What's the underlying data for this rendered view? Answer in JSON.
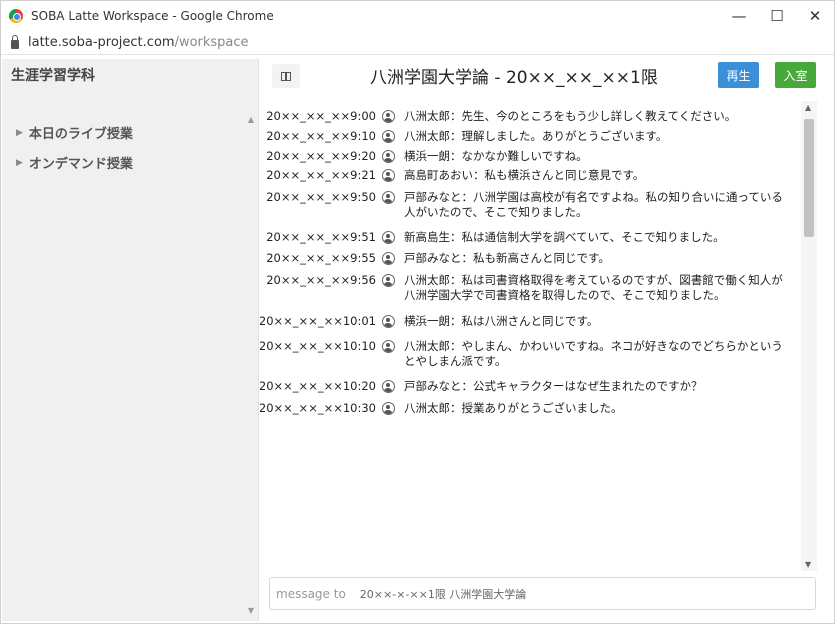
{
  "window": {
    "title": "SOBA Latte Workspace - Google Chrome",
    "controls": {
      "minimize": "—",
      "maximize": "☐",
      "close": "✕"
    }
  },
  "address": {
    "host": "latte.soba-project.com",
    "path": "/workspace"
  },
  "sidebar": {
    "title": "生涯学習学科",
    "items": [
      {
        "label": "本日のライブ授業"
      },
      {
        "label": "オンデマンド授業"
      }
    ]
  },
  "header": {
    "room_title": "八洲学園大学論 - 20××_××_××1限",
    "play_label": "再生",
    "enter_label": "入室"
  },
  "messages": [
    {
      "time": "20××_××_××9:00",
      "text": "八洲太郎：先生、今のところをもう少し詳しく教えてください。"
    },
    {
      "time": "20××_××_××9:10",
      "text": "八洲太郎：理解しました。ありがとうございます。"
    },
    {
      "time": "20××_××_××9:20",
      "text": "横浜一朗：なかなか難しいですね。"
    },
    {
      "time": "20××_××_××9:21",
      "text": "高島町あおい：私も横浜さんと同じ意見です。"
    },
    {
      "time": "20××_××_××9:50",
      "text": "戸部みなと：八洲学園は高校が有名ですよね。私の知り合いに通っている人がいたので、そこで知りました。"
    },
    {
      "time": "20××_××_××9:51",
      "text": "新高島生：私は通信制大学を調べていて、そこで知りました。"
    },
    {
      "time": "20××_××_××9:55",
      "text": "戸部みなと：私も新高さんと同じです。"
    },
    {
      "time": "20××_××_××9:56",
      "text": "八洲太郎：私は司書資格取得を考えているのですが、図書館で働く知人が八洲学園大学で司書資格を取得したので、そこで知りました。"
    },
    {
      "time": "20××_××_××10:01",
      "text": "横浜一朗：私は八洲さんと同じです。"
    },
    {
      "time": "20××_××_××10:10",
      "text": "八洲太郎：やしまん、かわいいですね。ネコが好きなのでどちらかというとやしまん派です。"
    },
    {
      "time": "20××_××_××10:20",
      "text": "戸部みなと：公式キャラクターはなぜ生まれたのですか？"
    },
    {
      "time": "20××_××_××10:30",
      "text": "八洲太郎：授業ありがとうございました。"
    }
  ],
  "composer": {
    "label": "message to",
    "value": "20××-×-××1限 八洲学園大学論"
  }
}
